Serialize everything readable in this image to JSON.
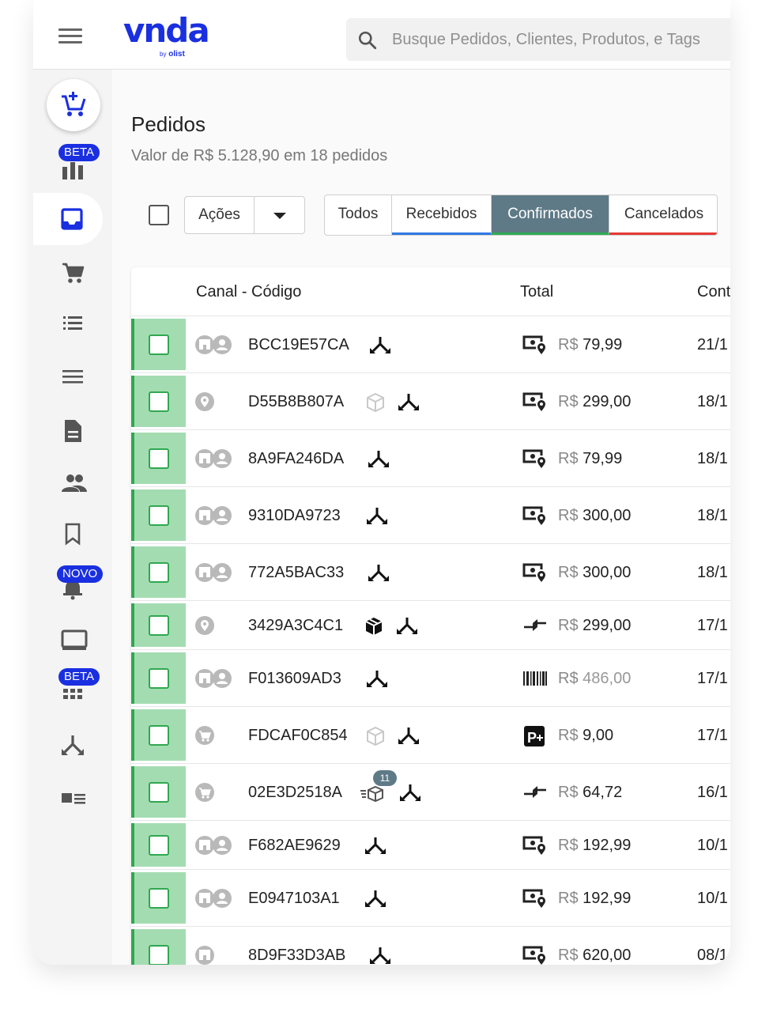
{
  "brand": {
    "logo": "vnda",
    "by": "by",
    "partner": "olist"
  },
  "search": {
    "placeholder": "Busque Pedidos, Clientes, Produtos, e Tags"
  },
  "sidebar": {
    "badges": {
      "beta_1": "BETA",
      "novo": "NOVO",
      "beta_2": "BETA"
    },
    "items": [
      "new-order",
      "reports",
      "orders",
      "cart",
      "list",
      "menu",
      "document",
      "customers",
      "bookmark",
      "notifications",
      "display",
      "grid",
      "integrations",
      "catalog"
    ]
  },
  "header": {
    "title": "Pedidos",
    "subtitle": "Valor de R$ 5.128,90 em 18 pedidos"
  },
  "toolbar": {
    "actions_label": "Ações",
    "filters": [
      "Todos",
      "Recebidos",
      "Confirmados",
      "Cancelados"
    ],
    "active_filter": "Confirmados"
  },
  "table": {
    "columns": [
      "Canal - Código",
      "Total",
      "Cont"
    ],
    "rows": [
      {
        "code": "BCC19E57CA",
        "channel": "store-person",
        "extras": [
          "split"
        ],
        "pay": "money",
        "currency": "R$",
        "value": "79,99",
        "date": "21/1"
      },
      {
        "code": "D55B8B807A",
        "channel": "pin",
        "extras": [
          "box-outline",
          "split"
        ],
        "pay": "money",
        "currency": "R$",
        "value": "299,00",
        "date": "18/1"
      },
      {
        "code": "8A9FA246DA",
        "channel": "store-person",
        "extras": [
          "split"
        ],
        "pay": "money",
        "currency": "R$",
        "value": "79,99",
        "date": "18/1"
      },
      {
        "code": "9310DA9723",
        "channel": "store-person",
        "extras": [
          "split"
        ],
        "pay": "money",
        "currency": "R$",
        "value": "300,00",
        "date": "18/1"
      },
      {
        "code": "772A5BAC33",
        "channel": "store-person",
        "extras": [
          "split"
        ],
        "pay": "money",
        "currency": "R$",
        "value": "300,00",
        "date": "18/1"
      },
      {
        "code": "3429A3C4C1",
        "channel": "pin",
        "extras": [
          "box-filled",
          "split"
        ],
        "pay": "transfer",
        "currency": "R$",
        "value": "299,00",
        "date": "17/1"
      },
      {
        "code": "F013609AD3",
        "channel": "store-person",
        "extras": [
          "split"
        ],
        "pay": "barcode",
        "currency": "R$",
        "value": "486,00",
        "date": "17/1",
        "muted": true
      },
      {
        "code": "FDCAF0C854",
        "channel": "cart",
        "extras": [
          "box-outline",
          "split"
        ],
        "pay": "pix",
        "currency": "R$",
        "value": "9,00",
        "date": "17/1"
      },
      {
        "code": "02E3D2518A",
        "channel": "cart",
        "extras": [
          "fast-box",
          "split"
        ],
        "count": "11",
        "pay": "transfer",
        "currency": "R$",
        "value": "64,72",
        "date": "16/1"
      },
      {
        "code": "F682AE9629",
        "channel": "store-person",
        "extras": [
          "split"
        ],
        "pay": "money",
        "currency": "R$",
        "value": "192,99",
        "date": "10/1"
      },
      {
        "code": "E0947103A1",
        "channel": "store-person",
        "extras": [
          "split"
        ],
        "pay": "money",
        "currency": "R$",
        "value": "192,99",
        "date": "10/1"
      },
      {
        "code": "8D9F33D3AB",
        "channel": "store",
        "extras": [
          "split"
        ],
        "pay": "money",
        "currency": "R$",
        "value": "620,00",
        "date": "08/1"
      }
    ]
  },
  "colors": {
    "brand": "#1a2fe0",
    "active_filter_bg": "#5f7a87",
    "confirmed_green": "#2fa84f",
    "row_strip": "#a4dcb2",
    "cancel_red": "#e53935",
    "received_blue": "#2f78e4"
  }
}
